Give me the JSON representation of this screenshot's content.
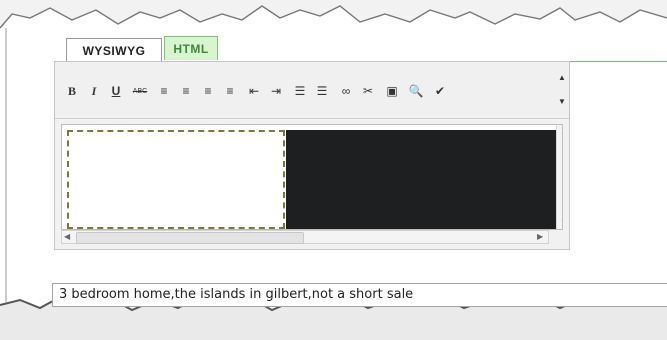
{
  "tabs": {
    "wysiwyg_label": "WYSIWYG",
    "html_label": "HTML"
  },
  "toolbar": {
    "buttons": [
      {
        "name": "bold-icon",
        "glyph": "B"
      },
      {
        "name": "italic-icon",
        "glyph": "I"
      },
      {
        "name": "underline-icon",
        "glyph": "U"
      },
      {
        "name": "strikethrough-icon",
        "glyph": "ABC"
      },
      {
        "name": "align-left-icon",
        "glyph": "≡"
      },
      {
        "name": "align-center-icon",
        "glyph": "≡"
      },
      {
        "name": "align-right-icon",
        "glyph": "≡"
      },
      {
        "name": "align-justify-icon",
        "glyph": "≡"
      },
      {
        "name": "outdent-icon",
        "glyph": "⇤"
      },
      {
        "name": "indent-icon",
        "glyph": "⇥"
      },
      {
        "name": "bullet-list-icon",
        "glyph": "☰"
      },
      {
        "name": "numbered-list-icon",
        "glyph": "☰"
      },
      {
        "name": "link-icon",
        "glyph": "∞"
      },
      {
        "name": "unlink-icon",
        "glyph": "✂"
      },
      {
        "name": "insert-image-icon",
        "glyph": "▣"
      },
      {
        "name": "preview-icon",
        "glyph": "🔍"
      },
      {
        "name": "spellcheck-icon",
        "glyph": "✔"
      }
    ]
  },
  "description_field": {
    "value": "3 bedroom home,the islands in gilbert,not a short sale"
  },
  "colors": {
    "html_tab_bg": "#d8f5d0",
    "tab_line": "#6cc36c",
    "dark_image": "#1d1f21"
  }
}
